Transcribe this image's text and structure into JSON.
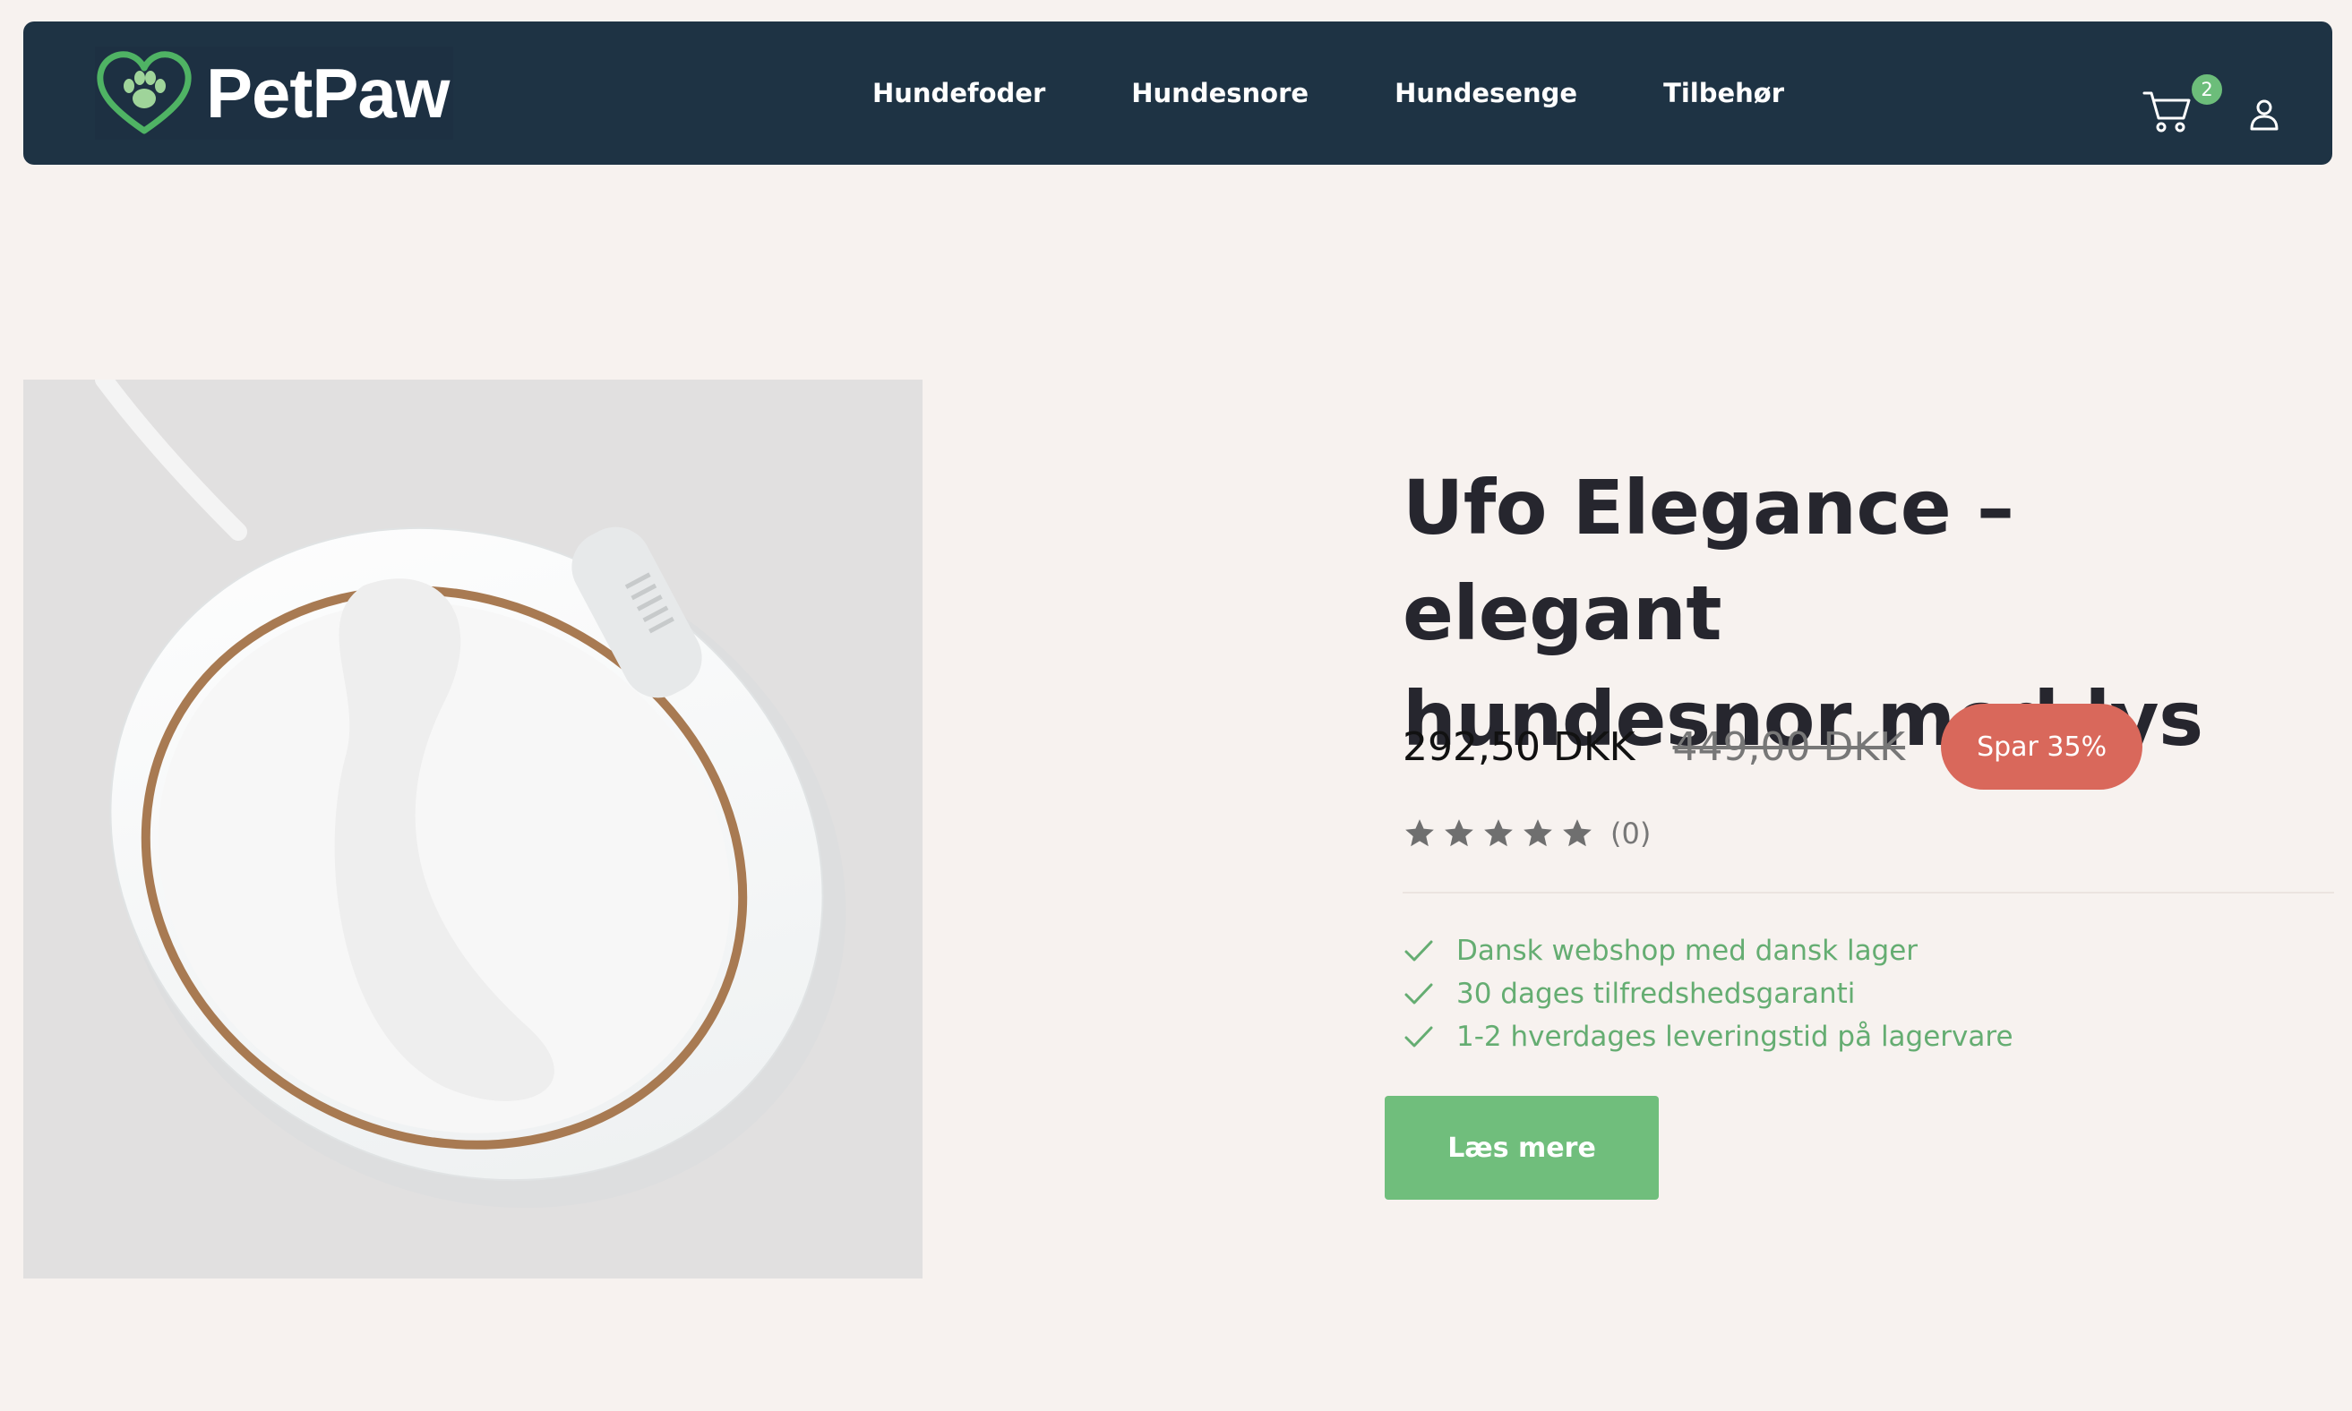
{
  "header": {
    "logo_text": "PetPaw",
    "nav": [
      "Hundefoder",
      "Hundesnore",
      "Hundesenge",
      "Tilbehør"
    ],
    "cart_count": "2",
    "cart_icon": "cart-icon",
    "account_icon": "user-icon"
  },
  "product": {
    "image_icon": "retractable-leash-product-photo",
    "title_line1": "Ufo Elegance – elegant",
    "title_line2": "hundesnor med lys",
    "price": "292,50 DKK",
    "old_price": "449,00 DKK",
    "save_badge": "Spar 35%",
    "rating_stars": 5,
    "rating_count": "(0)",
    "usps": [
      "Dansk webshop med dansk lager",
      "30 dages tilfredshedsgaranti",
      "1-2 hverdages leveringstid på lagervare"
    ],
    "cta_label": "Læs mere"
  },
  "colors": {
    "background": "#f7f2ef",
    "header": "#1e3344",
    "accent_green": "#70be7c",
    "sale_badge": "#d9685b",
    "heading_text": "#26262e"
  }
}
